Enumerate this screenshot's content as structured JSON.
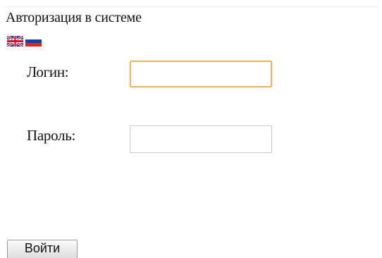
{
  "page": {
    "title": "Авторизация в системе"
  },
  "languages": [
    {
      "code": "en",
      "icon": "uk-flag-icon"
    },
    {
      "code": "ru",
      "icon": "russia-flag-icon"
    }
  ],
  "form": {
    "login_label": "Логин:",
    "login_value": "",
    "password_label": "Пароль:",
    "password_value": "",
    "submit_label": "Войти"
  },
  "colors": {
    "focused_border": "#e2b86a",
    "input_border": "#c9c9c9"
  }
}
